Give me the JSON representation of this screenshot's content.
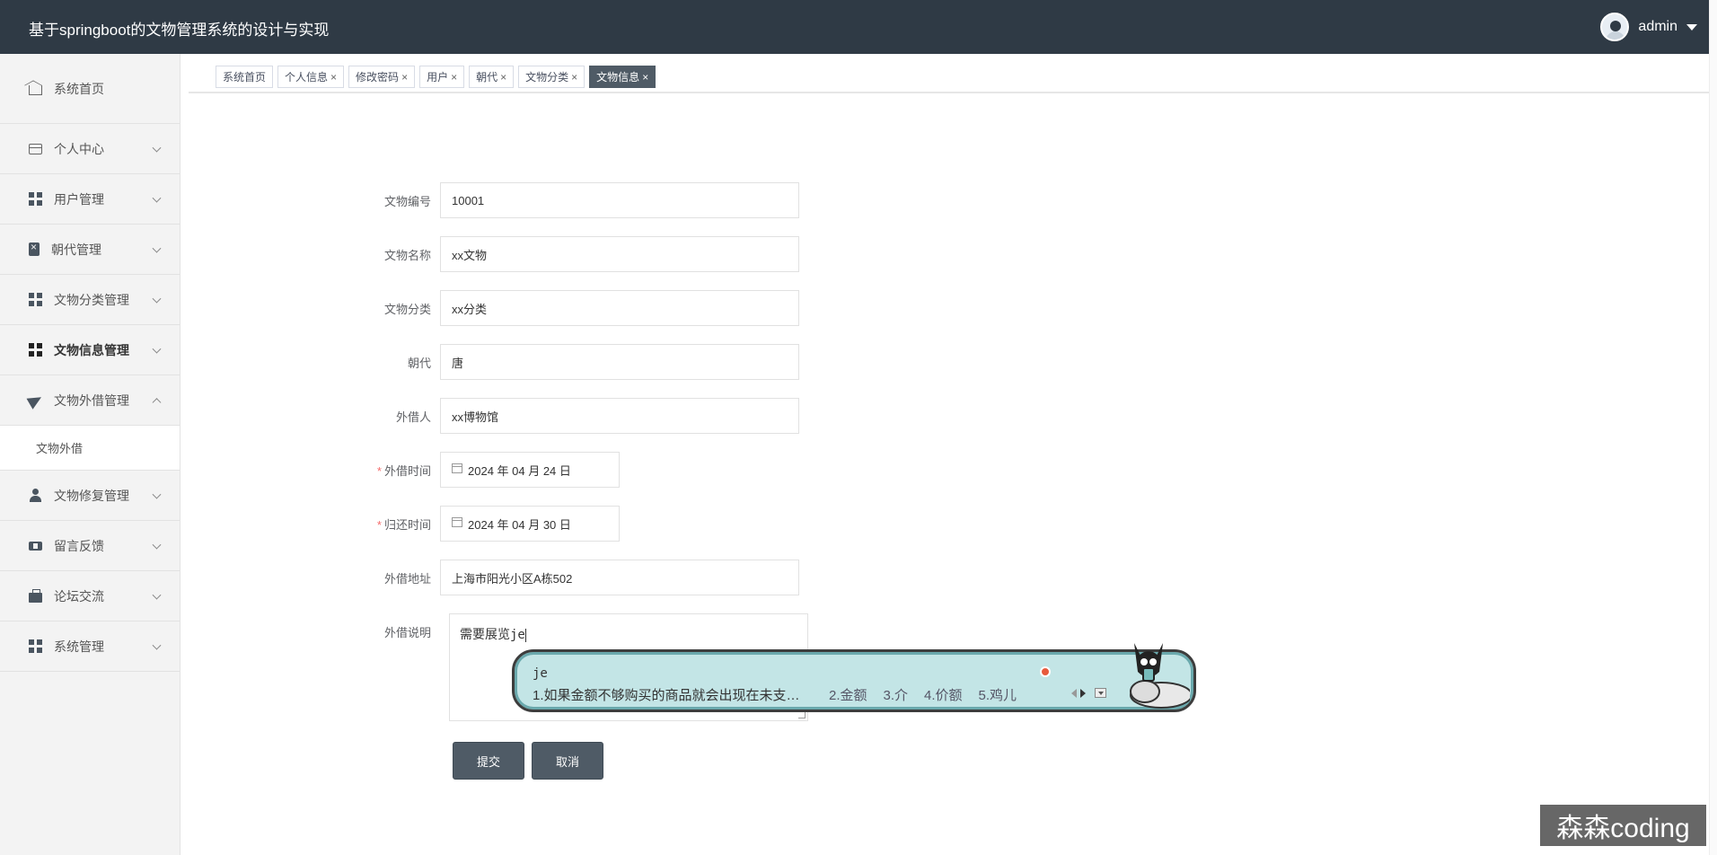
{
  "app": {
    "title": "基于springboot的文物管理系统的设计与实现",
    "username": "admin"
  },
  "sidebar": {
    "items": [
      {
        "label": "系统首页",
        "icon": "home-icon"
      },
      {
        "label": "个人中心",
        "icon": "card-icon"
      },
      {
        "label": "用户管理",
        "icon": "grid-icon"
      },
      {
        "label": "朝代管理",
        "icon": "clipboard-icon"
      },
      {
        "label": "文物分类管理",
        "icon": "grid-icon"
      },
      {
        "label": "文物信息管理",
        "icon": "grid-icon"
      },
      {
        "label": "文物外借管理",
        "icon": "paper-plane-icon",
        "expanded": true
      },
      {
        "label": "文物修复管理",
        "icon": "user-icon"
      },
      {
        "label": "留言反馈",
        "icon": "ticket-icon"
      },
      {
        "label": "论坛交流",
        "icon": "briefcase-icon"
      },
      {
        "label": "系统管理",
        "icon": "grid-icon"
      }
    ],
    "sub_item": "文物外借"
  },
  "tabs": [
    {
      "label": "系统首页",
      "closable": false
    },
    {
      "label": "个人信息",
      "closable": true
    },
    {
      "label": "修改密码",
      "closable": true
    },
    {
      "label": "用户",
      "closable": true
    },
    {
      "label": "朝代",
      "closable": true
    },
    {
      "label": "文物分类",
      "closable": true
    },
    {
      "label": "文物信息",
      "closable": true,
      "active": true
    }
  ],
  "tab_close_glyph": "×",
  "form": {
    "fields": [
      {
        "label": "文物编号",
        "value": "10001"
      },
      {
        "label": "文物名称",
        "value": "xx文物"
      },
      {
        "label": "文物分类",
        "value": "xx分类"
      },
      {
        "label": "朝代",
        "value": "唐"
      },
      {
        "label": "外借人",
        "value": "xx博物馆"
      },
      {
        "label": "外借时间",
        "value": "2024 年 04 月 24 日",
        "required": true
      },
      {
        "label": "归还时间",
        "value": "2024 年 04 月 30 日",
        "required": true
      },
      {
        "label": "外借地址",
        "value": "上海市阳光小区A栋502"
      }
    ],
    "note_label": "外借说明",
    "note_value": "需要展览",
    "note_composing": "je",
    "required_mark": "*",
    "submit_label": "提交",
    "cancel_label": "取消"
  },
  "ime": {
    "composition": "je",
    "candidates": [
      "1.如果金额不够购买的商品就会出现在未支…",
      "2.金额",
      "3.介",
      "4.价额",
      "5.鸡儿"
    ]
  },
  "watermark": "森森coding",
  "colors": {
    "header_bg": "#2f3a45",
    "active_tab": "#4f5b66",
    "button": "#4f5b66",
    "required": "#f56c6c",
    "ime_bg": "#c3e5e6"
  }
}
